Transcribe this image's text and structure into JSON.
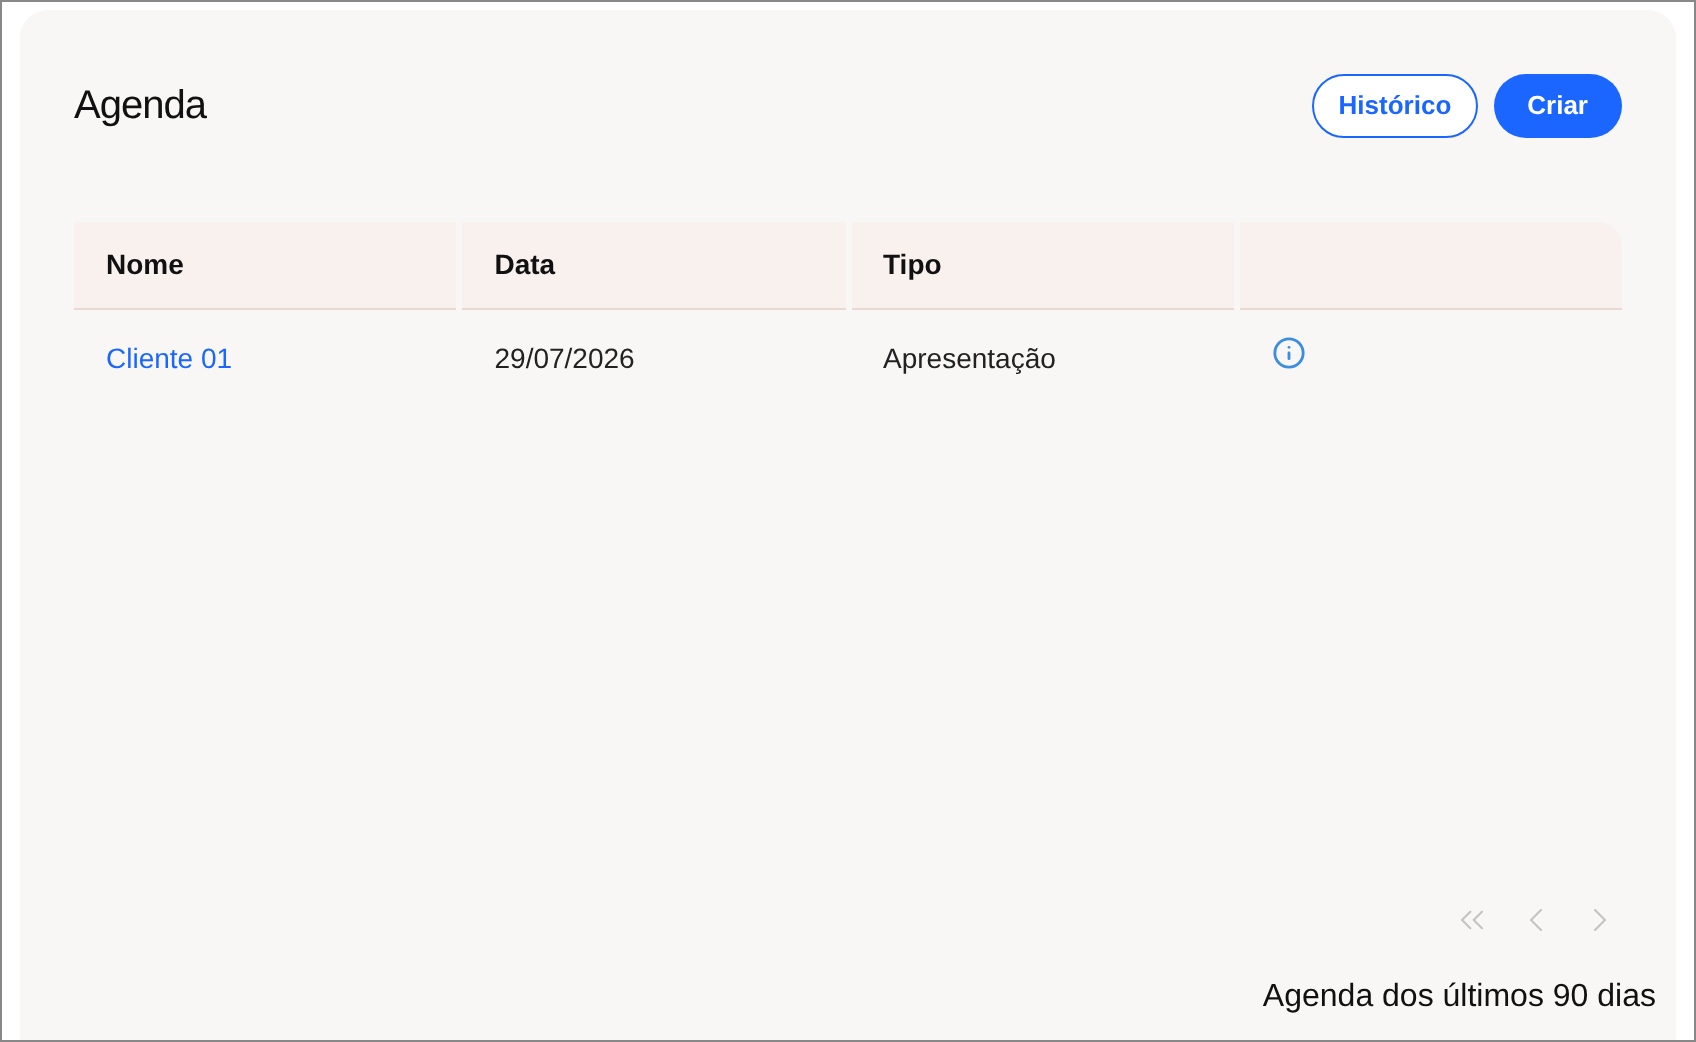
{
  "title": "Agenda",
  "buttons": [
    {
      "label": "Histórico",
      "kind": "outline"
    },
    {
      "label": "Criar",
      "kind": "filled"
    }
  ],
  "table": {
    "columns": [
      "Nome",
      "Data",
      "Tipo",
      ""
    ],
    "rows": [
      {
        "name": "Cliente 01",
        "date": "29/07/2026",
        "type": "Apresentação"
      }
    ]
  },
  "pagination": {
    "first_disabled": true,
    "prev_disabled": true,
    "next_disabled": true
  },
  "footer": "Agenda dos últimos 90 dias"
}
